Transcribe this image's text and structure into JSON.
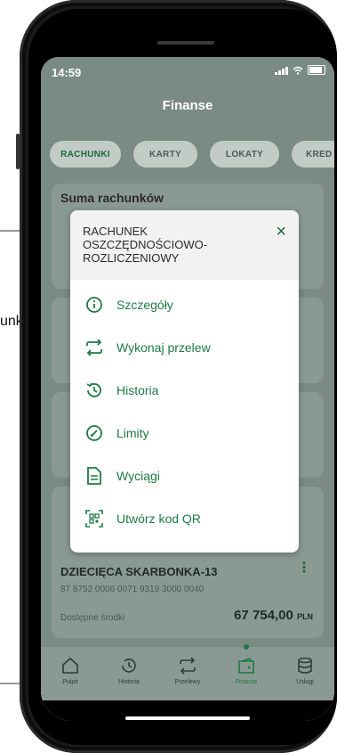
{
  "side_label": "unku",
  "status": {
    "time": "14:59"
  },
  "header": {
    "title": "Finanse"
  },
  "tabs": [
    {
      "label": "RACHUNKI",
      "active": true
    },
    {
      "label": "KARTY",
      "active": false
    },
    {
      "label": "LOKATY",
      "active": false
    },
    {
      "label": "KRED",
      "active": false
    }
  ],
  "summary_card": {
    "title": "Suma rachunków"
  },
  "modal": {
    "title": "RACHUNEK OSZCZĘDNOŚCIOWO-ROZLICZENIOWY",
    "close_symbol": "×",
    "items": [
      {
        "label": "Szczegóły",
        "icon": "info-icon"
      },
      {
        "label": "Wykonaj przelew",
        "icon": "transfer-icon"
      },
      {
        "label": "Historia",
        "icon": "history-icon"
      },
      {
        "label": "Limity",
        "icon": "gauge-icon"
      },
      {
        "label": "Wyciągi",
        "icon": "document-icon"
      },
      {
        "label": "Utwórz kod QR",
        "icon": "qr-code-icon"
      }
    ]
  },
  "account": {
    "name": "DZIECIĘCA SKARBONKA-13",
    "number": "87 8752 0006 0071 9319 3000 0040",
    "available_label": "Dostępne środki",
    "amount": "67 754,00",
    "currency": "PLN"
  },
  "bottom_nav": [
    {
      "label": "Pulpit",
      "icon": "home-icon",
      "active": false
    },
    {
      "label": "Historia",
      "icon": "history-icon",
      "active": false
    },
    {
      "label": "Przelewy",
      "icon": "transfer-icon",
      "active": false
    },
    {
      "label": "Finanse",
      "icon": "finance-icon",
      "active": true
    },
    {
      "label": "Usługi",
      "icon": "database-icon",
      "active": false
    }
  ],
  "colors": {
    "accent": "#1e7a45",
    "overlay": "#7a8a84"
  }
}
